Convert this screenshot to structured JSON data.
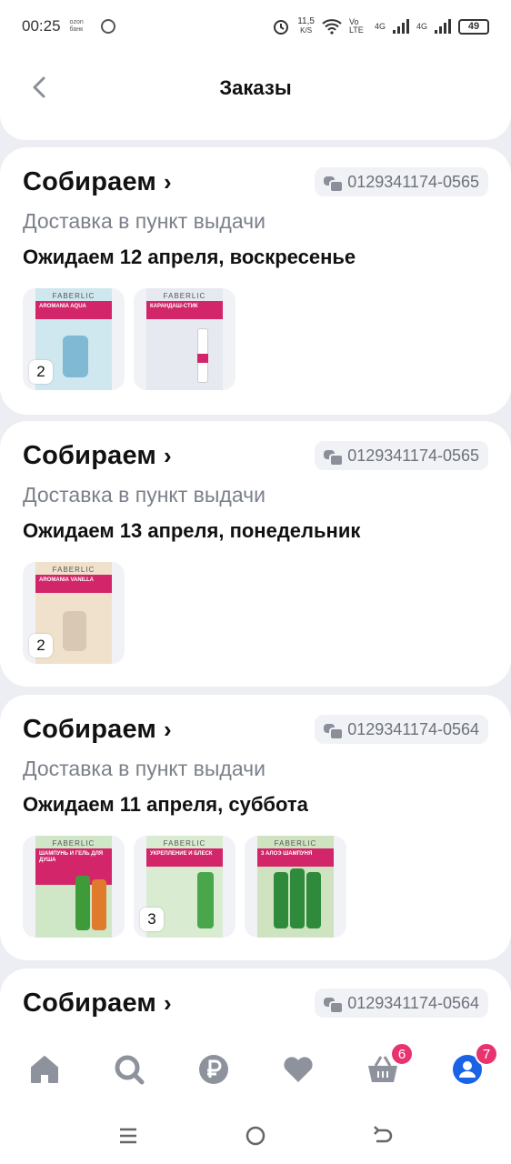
{
  "status_bar": {
    "time": "00:25",
    "bank_label": "ozon банк",
    "speed": "11,5",
    "speed_unit": "K/S",
    "volte": "Vo LTE",
    "net1": "4G",
    "net2": "4G",
    "battery": "49"
  },
  "header": {
    "title": "Заказы"
  },
  "orders": [
    {
      "status": "Собираем",
      "number": "0129341174-0565",
      "delivery": "Доставка в пункт выдачи",
      "expected": "Ожидаем 12 апреля, воскресенье",
      "products": [
        {
          "brand": "FABERLIC",
          "name": "AROMANIA AQUA",
          "quantity": "2",
          "color": "#cfe7ef"
        },
        {
          "brand": "FABERLIC",
          "name": "КАРАНДАШ-СТИК",
          "quantity": "",
          "color": "#e6e9ef"
        }
      ]
    },
    {
      "status": "Собираем",
      "number": "0129341174-0565",
      "delivery": "Доставка в пункт выдачи",
      "expected": "Ожидаем 13 апреля, понедельник",
      "products": [
        {
          "brand": "FABERLIC",
          "name": "AROMANIA VANILLA",
          "quantity": "2",
          "color": "#efe1cc"
        }
      ]
    },
    {
      "status": "Собираем",
      "number": "0129341174-0564",
      "delivery": "Доставка в пункт выдачи",
      "expected": "Ожидаем 11 апреля, суббота",
      "products": [
        {
          "brand": "FABERLIC",
          "name": "ШАМПУНЬ И ГЕЛЬ ДЛЯ ДУША",
          "quantity": "",
          "color": "#cfe6c7"
        },
        {
          "brand": "FABERLIC",
          "name": "УКРЕПЛЕНИЕ И БЛЕСК",
          "quantity": "3",
          "color": "#d9ecd1"
        },
        {
          "brand": "FABERLIC",
          "name": "3 АЛОЭ ШАМПУНЯ",
          "quantity": "",
          "color": "#cfe3c0"
        }
      ]
    },
    {
      "status": "Собираем",
      "number": "0129341174-0564",
      "delivery": "",
      "expected": "",
      "products": []
    }
  ],
  "bottom_nav": {
    "items": [
      {
        "icon": "home-icon"
      },
      {
        "icon": "search-icon"
      },
      {
        "icon": "ruble-icon"
      },
      {
        "icon": "heart-icon"
      },
      {
        "icon": "cart-icon",
        "badge": "6"
      },
      {
        "icon": "profile-icon",
        "badge": "7"
      }
    ]
  },
  "colors": {
    "accent": "#1a62e6",
    "badge": "#e8336f",
    "brand_band": "#d3266a"
  }
}
